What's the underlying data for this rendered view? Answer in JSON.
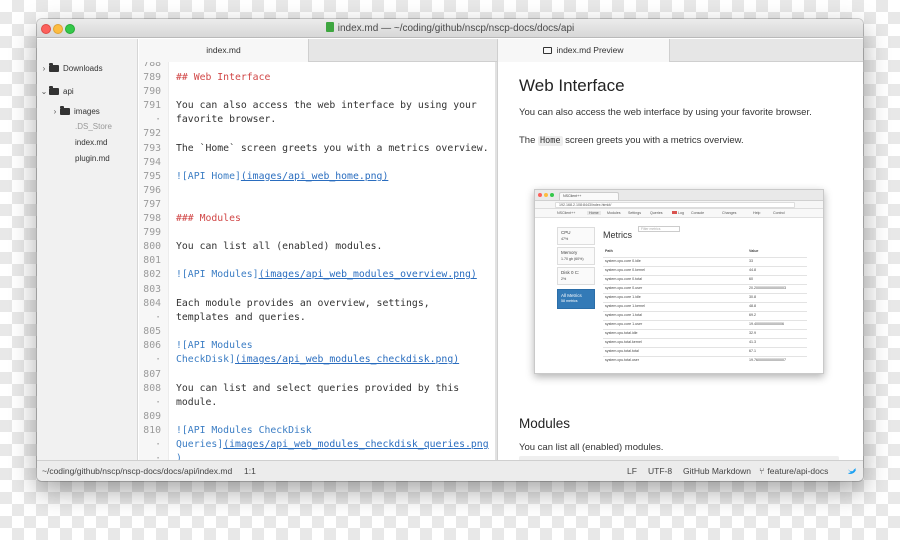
{
  "window": {
    "title": "index.md — ~/coding/github/nscp/nscp-docs/docs/api"
  },
  "sidebar": {
    "items": [
      {
        "label": "Downloads",
        "type": "folder",
        "expanded": false
      },
      {
        "label": "api",
        "type": "folder",
        "expanded": true
      },
      {
        "label": "images",
        "type": "folder",
        "expanded": false
      },
      {
        "label": ".DS_Store",
        "type": "file",
        "dimmed": true
      },
      {
        "label": "index.md",
        "type": "file"
      },
      {
        "label": "plugin.md",
        "type": "file"
      }
    ]
  },
  "tabs": {
    "editor": "index.md",
    "preview": "index.md Preview"
  },
  "editor": {
    "lines": [
      {
        "n": "788",
        "text": ""
      },
      {
        "n": "789",
        "text": "## Web Interface"
      },
      {
        "n": "790",
        "text": ""
      },
      {
        "n": "791",
        "text": "You can also access the web interface by using your"
      },
      {
        "n": "·",
        "text": "favorite browser."
      },
      {
        "n": "792",
        "text": ""
      },
      {
        "n": "793",
        "text": "The `Home` screen greets you with a metrics overview."
      },
      {
        "n": "794",
        "text": ""
      },
      {
        "n": "795",
        "text_a": "![API Home]",
        "text_b": "(images/api_web_home.png)"
      },
      {
        "n": "796",
        "text": ""
      },
      {
        "n": "797",
        "text": ""
      },
      {
        "n": "798",
        "text": "### Modules"
      },
      {
        "n": "799",
        "text": ""
      },
      {
        "n": "800",
        "text": "You can list all (enabled) modules."
      },
      {
        "n": "801",
        "text": ""
      },
      {
        "n": "802",
        "text_a": "![API Modules]",
        "text_b": "(images/api_web_modules_overview.png)"
      },
      {
        "n": "803",
        "text": ""
      },
      {
        "n": "804",
        "text": "Each module provides an overview, settings,"
      },
      {
        "n": "·",
        "text": "templates and queries."
      },
      {
        "n": "805",
        "text": ""
      },
      {
        "n": "806",
        "text": "![API Modules"
      },
      {
        "n": "·",
        "text_a": "CheckDisk]",
        "text_b": "(images/api_web_modules_checkdisk.png)"
      },
      {
        "n": "807",
        "text": ""
      },
      {
        "n": "808",
        "text": "You can list and select queries provided by this"
      },
      {
        "n": "·",
        "text": "module."
      },
      {
        "n": "809",
        "text": ""
      },
      {
        "n": "810",
        "text": "![API Modules CheckDisk"
      },
      {
        "n": "·",
        "text_a": "Queries]",
        "text_b": "(images/api_web_modules_checkdisk_queries.png"
      },
      {
        "n": "·",
        "text": ")"
      }
    ]
  },
  "preview": {
    "h1": "Web Interface",
    "p1": "You can also access the web interface by using your favorite browser.",
    "p2_before": "The ",
    "p2_code": "Home",
    "p2_after": " screen greets you with a metrics overview.",
    "h2": "Modules",
    "p3": "You can list all (enabled) modules.",
    "screenshot": {
      "tab_label": "NSClient++",
      "url": "192.168.2.108:8443/index.html#/",
      "nav": [
        "NSClient++",
        "Home",
        "Modules",
        "Settings",
        "Queries",
        "Log",
        "Console",
        "Changes",
        "Help",
        "Control"
      ],
      "side": [
        {
          "title": "CPU",
          "sub": "47%"
        },
        {
          "title": "Memory",
          "sub": "1.70 gb (60%)"
        },
        {
          "title": "Disk 0 C:",
          "sub": "2%"
        },
        {
          "title": "All Metrics",
          "sub": "58 metrics",
          "active": true
        }
      ],
      "heading": "Metrics",
      "filter_placeholder": "Filter metrics",
      "columns": [
        "Path",
        "Value"
      ],
      "rows": [
        [
          "system.cpu.core 0.idle",
          "33"
        ],
        [
          "system.cpu.core 0.kernel",
          "44.8"
        ],
        [
          "system.cpu.core 0.total",
          "60"
        ],
        [
          "system.cpu.core 0.user",
          "20.2000000000000003"
        ],
        [
          "system.cpu.core 1.idle",
          "30.8"
        ],
        [
          "system.cpu.core 1.kernel",
          "48.8"
        ],
        [
          "system.cpu.core 1.total",
          "69.2"
        ],
        [
          "system.cpu.core 1.user",
          "19.400000000000006"
        ],
        [
          "system.cpu.total.idle",
          "32.9"
        ],
        [
          "system.cpu.total.kernel",
          "41.3"
        ],
        [
          "system.cpu.total.total",
          "67.1"
        ],
        [
          "system.cpu.total.user",
          "19.7600000000000007"
        ]
      ]
    }
  },
  "statusbar": {
    "path": "~/coding/github/nscp/nscp-docs/docs/api/index.md",
    "cursor": "1:1",
    "line_ending": "LF",
    "encoding": "UTF-8",
    "grammar": "GitHub Markdown",
    "branch": "feature/api-docs"
  }
}
